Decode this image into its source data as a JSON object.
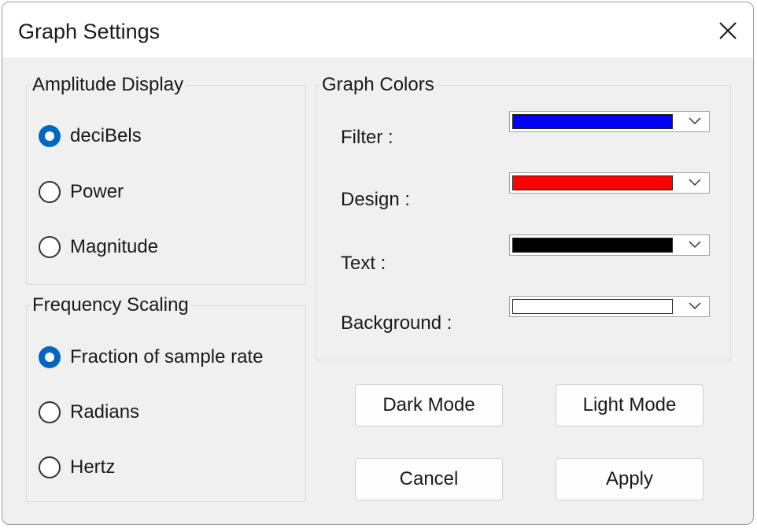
{
  "window": {
    "title": "Graph Settings",
    "close_icon": "close-icon"
  },
  "amplitude_display": {
    "label": "Amplitude Display",
    "options": [
      {
        "label": "deciBels",
        "checked": true
      },
      {
        "label": "Power",
        "checked": false
      },
      {
        "label": "Magnitude",
        "checked": false
      }
    ]
  },
  "frequency_scaling": {
    "label": "Frequency Scaling",
    "options": [
      {
        "label": "Fraction of sample rate",
        "checked": true
      },
      {
        "label": "Radians",
        "checked": false
      },
      {
        "label": "Hertz",
        "checked": false
      }
    ]
  },
  "graph_colors": {
    "label": "Graph Colors",
    "items": [
      {
        "label": "Filter :",
        "color": "#0000ff"
      },
      {
        "label": "Design :",
        "color": "#ff0000"
      },
      {
        "label": "Text :",
        "color": "#000000"
      },
      {
        "label": "Background :",
        "color": "#ffffff"
      }
    ]
  },
  "buttons": {
    "dark_mode": "Dark Mode",
    "light_mode": "Light Mode",
    "cancel": "Cancel",
    "apply": "Apply"
  },
  "colors": {
    "accent": "#0067c0"
  }
}
